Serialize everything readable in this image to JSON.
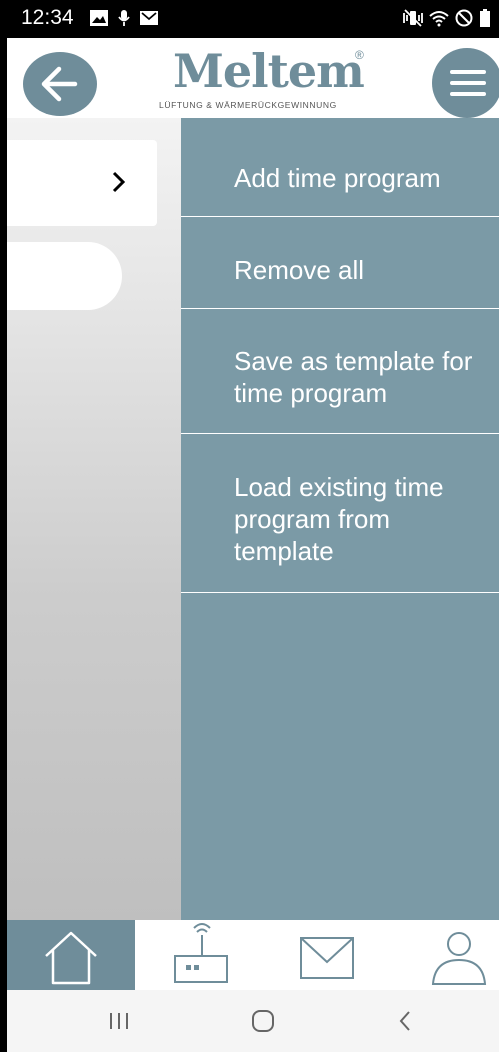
{
  "status_bar": {
    "time": "12:34"
  },
  "header": {
    "logo_text": "Meltem",
    "logo_tagline": "LÜFTUNG & WÄRMERÜCKGEWINNUNG",
    "logo_reg": "®"
  },
  "drawer": {
    "items": [
      {
        "label": "Add time program"
      },
      {
        "label": "Remove all"
      },
      {
        "label": "Save as template for\ntime program"
      },
      {
        "label": "Load existing time\nprogram from\ntemplate"
      }
    ]
  },
  "colors": {
    "accent": "#6f8d9a",
    "drawer_bg": "#7b9aa6"
  },
  "icons": {
    "back": "arrow-left-icon",
    "menu": "hamburger-icon",
    "tab_home": "house-icon",
    "tab_device": "router-icon",
    "tab_mail": "envelope-icon",
    "tab_user": "person-icon"
  }
}
